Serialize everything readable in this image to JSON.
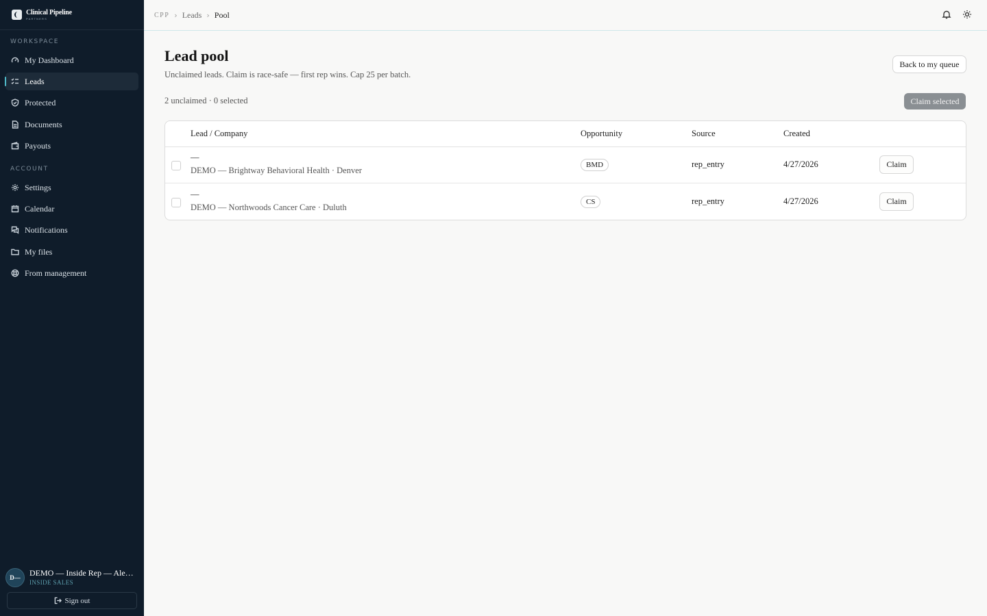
{
  "brand": {
    "name": "Clinical Pipeline",
    "sub": "PARTNERS"
  },
  "sidebar": {
    "workspace_label": "WORKSPACE",
    "account_label": "ACCOUNT",
    "workspace_items": [
      {
        "label": "My Dashboard",
        "icon": "gauge-icon"
      },
      {
        "label": "Leads",
        "icon": "list-check-icon",
        "active": true
      },
      {
        "label": "Protected",
        "icon": "shield-check-icon"
      },
      {
        "label": "Documents",
        "icon": "document-icon"
      },
      {
        "label": "Payouts",
        "icon": "wallet-icon"
      }
    ],
    "account_items": [
      {
        "label": "Settings",
        "icon": "gear-icon"
      },
      {
        "label": "Calendar",
        "icon": "calendar-icon"
      },
      {
        "label": "Notifications",
        "icon": "message-icon"
      },
      {
        "label": "My files",
        "icon": "folder-icon"
      },
      {
        "label": "From management",
        "icon": "lifebuoy-icon"
      }
    ],
    "user": {
      "initials": "D—",
      "name": "DEMO — Inside Rep — Alex Rivera",
      "role": "INSIDE SALES"
    },
    "sign_out": "Sign out"
  },
  "breadcrumb": {
    "root": "CPP",
    "parent": "Leads",
    "current": "Pool"
  },
  "page": {
    "title": "Lead pool",
    "subtitle": "Unclaimed leads. Claim is race-safe — first rep wins. Cap 25 per batch.",
    "back_button": "Back to my queue",
    "counts": "2 unclaimed · 0 selected",
    "claim_selected": "Claim selected"
  },
  "table": {
    "columns": [
      "Lead / Company",
      "Opportunity",
      "Source",
      "Created"
    ],
    "rows": [
      {
        "lead": "—",
        "company": "DEMO — Brightway Behavioral Health · Denver",
        "opportunity": "BMD",
        "source": "rep_entry",
        "created": "4/27/2026",
        "action": "Claim"
      },
      {
        "lead": "—",
        "company": "DEMO — Northwoods Cancer Care · Duluth",
        "opportunity": "CS",
        "source": "rep_entry",
        "created": "4/27/2026",
        "action": "Claim"
      }
    ]
  },
  "colors": {
    "sidebar_bg": "#0f1c2a",
    "accent": "#4fb9c8",
    "page_bg": "#f8f8f7",
    "disabled_button": "#8a8f93"
  }
}
